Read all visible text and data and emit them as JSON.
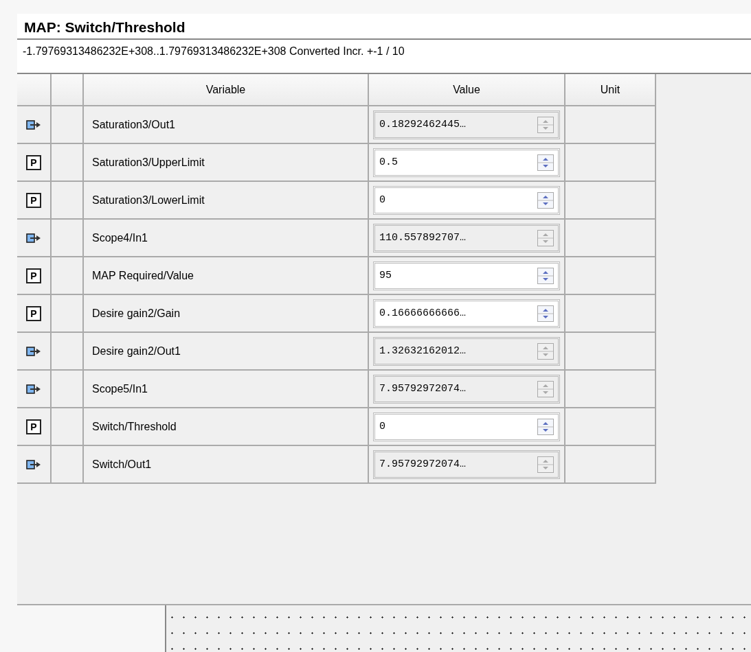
{
  "panel": {
    "title": "MAP:  Switch/Threshold",
    "range": "-1.79769313486232E+308..1.79769313486232E+308  Converted Incr. +-1 / 10"
  },
  "table": {
    "columns": [
      "Variable",
      "Value",
      "Unit"
    ],
    "rows": [
      {
        "kind": "signal",
        "variable": "Saturation3/Out1",
        "value": "0.18292462445…",
        "editable": false
      },
      {
        "kind": "parameter",
        "badge": "P",
        "variable": "Saturation3/UpperLimit",
        "value": "0.5",
        "editable": true
      },
      {
        "kind": "parameter",
        "badge": "P",
        "variable": "Saturation3/LowerLimit",
        "value": "0",
        "editable": true
      },
      {
        "kind": "signal",
        "variable": "Scope4/In1",
        "value": "110.557892707…",
        "editable": false
      },
      {
        "kind": "parameter",
        "badge": "P",
        "variable": "MAP Required/Value",
        "value": "95",
        "editable": true
      },
      {
        "kind": "parameter",
        "badge": "P",
        "variable": "Desire gain2/Gain",
        "value": "0.16666666666…",
        "editable": true
      },
      {
        "kind": "signal",
        "variable": "Desire gain2/Out1",
        "value": "1.32632162012…",
        "editable": false
      },
      {
        "kind": "signal",
        "variable": "Scope5/In1",
        "value": "7.95792972074…",
        "editable": false
      },
      {
        "kind": "parameter",
        "badge": "P",
        "variable": "Switch/Threshold",
        "value": "0",
        "editable": true
      },
      {
        "kind": "signal",
        "variable": "Switch/Out1",
        "value": "7.95792972074…",
        "editable": false
      }
    ]
  }
}
